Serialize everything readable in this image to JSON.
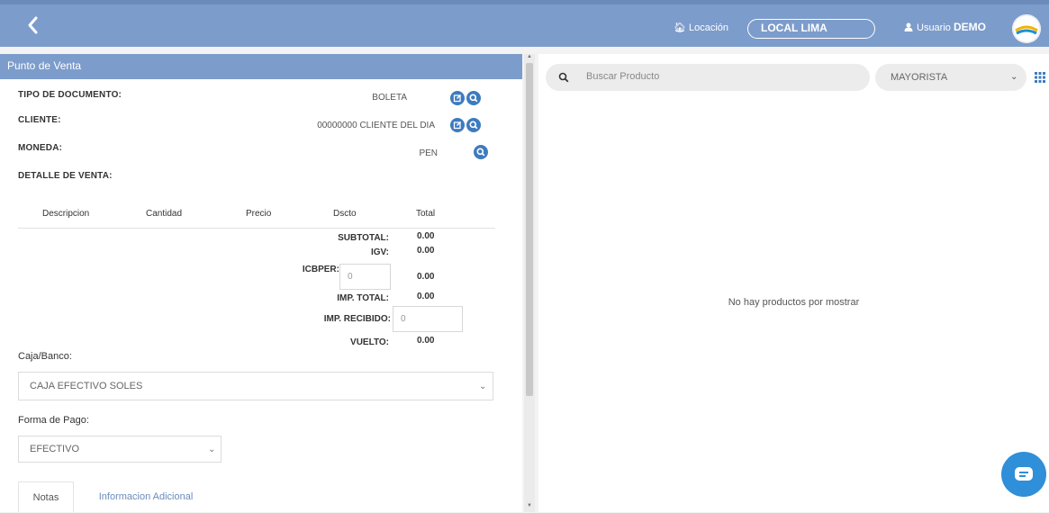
{
  "topbar": {
    "location_label": "Locación",
    "location_value": "LOCAL LIMA",
    "user_label": "Usuario",
    "user_name": "DEMO"
  },
  "left": {
    "header_title": "Punto de Venta",
    "doc_type_label": "TIPO DE DOCUMENTO:",
    "doc_type_value": "BOLETA",
    "client_label": "CLIENTE:",
    "client_value": "00000000 CLIENTE DEL DIA",
    "currency_label": "MONEDA:",
    "currency_value": "PEN",
    "detail_label": "DETALLE DE VENTA:",
    "table_headers": [
      "Descripcion",
      "Cantidad",
      "Precio",
      "Dscto",
      "Total"
    ],
    "summary": {
      "subtotal_label": "SUBTOTAL:",
      "subtotal_value": "0.00",
      "igv_label": "IGV:",
      "igv_value": "0.00",
      "icbper_label": "ICBPER:",
      "icbper_input": "0",
      "icbper_value": "0.00",
      "imp_total_label": "IMP. TOTAL:",
      "imp_total_value": "0.00",
      "imp_recibido_label": "IMP. RECIBIDO:",
      "imp_recibido_input": "0",
      "vuelto_label": "VUELTO:",
      "vuelto_value": "0.00"
    },
    "caja_label": "Caja/Banco:",
    "caja_value": "CAJA EFECTIVO SOLES",
    "forma_pago_label": "Forma de Pago:",
    "forma_pago_value": "EFECTIVO",
    "tabs": [
      "Notas",
      "Informacion Adicional"
    ]
  },
  "right": {
    "search_placeholder": "Buscar Producto",
    "price_list_value": "MAYORISTA",
    "empty_message": "No hay productos por mostrar"
  },
  "colors": {
    "header_blue": "#7c9ccb",
    "accent_blue": "#3d7bbf",
    "chat_blue": "#2f8fd8"
  }
}
